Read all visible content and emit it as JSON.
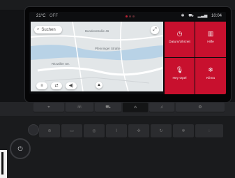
{
  "status": {
    "temperature": "21°C",
    "climate_state": "OFF",
    "time": "10:04"
  },
  "map": {
    "search_label": "Suchen",
    "labels": [
      "Bundesstraße 46",
      "Pfenninger Straße",
      "Ritzwiller Str."
    ]
  },
  "tiles": [
    {
      "label": "Datum/Uhrzeit",
      "icon": "clock-icon"
    },
    {
      "label": "Hilfe",
      "icon": "help-icon"
    },
    {
      "label": "Hey Opel",
      "icon": "microphone-icon"
    },
    {
      "label": "Klima",
      "icon": "climate-icon"
    }
  ],
  "colors": {
    "accent": "#c8102e"
  }
}
